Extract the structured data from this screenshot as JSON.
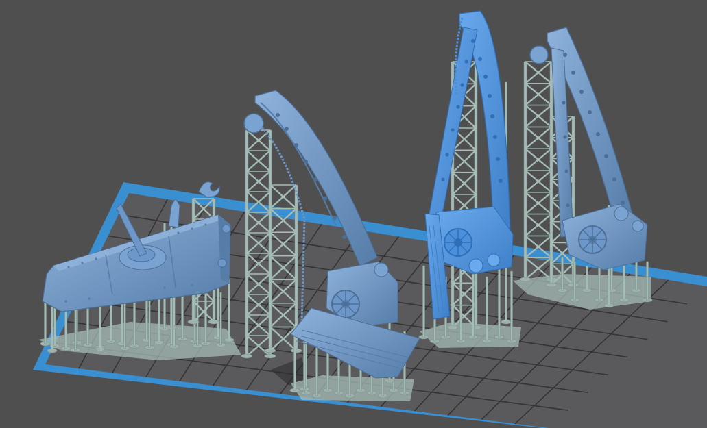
{
  "viewport": {
    "background_color": "#4f4f50",
    "grid_line_color": "#343436",
    "plate_border_color": "#3a8fd0",
    "plate_floor_color": "#5a5a5c"
  },
  "colors": {
    "support_fill": "#a4bbb6",
    "support_stroke": "#7d918d",
    "support_base_fill": "#9eb3ae",
    "model_fill": "#6d97c8",
    "model_shadow": "#557da8",
    "model_highlight": "#8eb2dc",
    "model_selected_fill": "#4c8fda",
    "model_selected_highlight": "#6aa9ec"
  },
  "scene": {
    "models": [
      {
        "name": "tank-hull-with-cannon",
        "selected": false
      },
      {
        "name": "crane-boom-small",
        "selected": false
      },
      {
        "name": "crane-boom-selected",
        "selected": true
      },
      {
        "name": "crane-boom-right",
        "selected": false
      }
    ]
  }
}
